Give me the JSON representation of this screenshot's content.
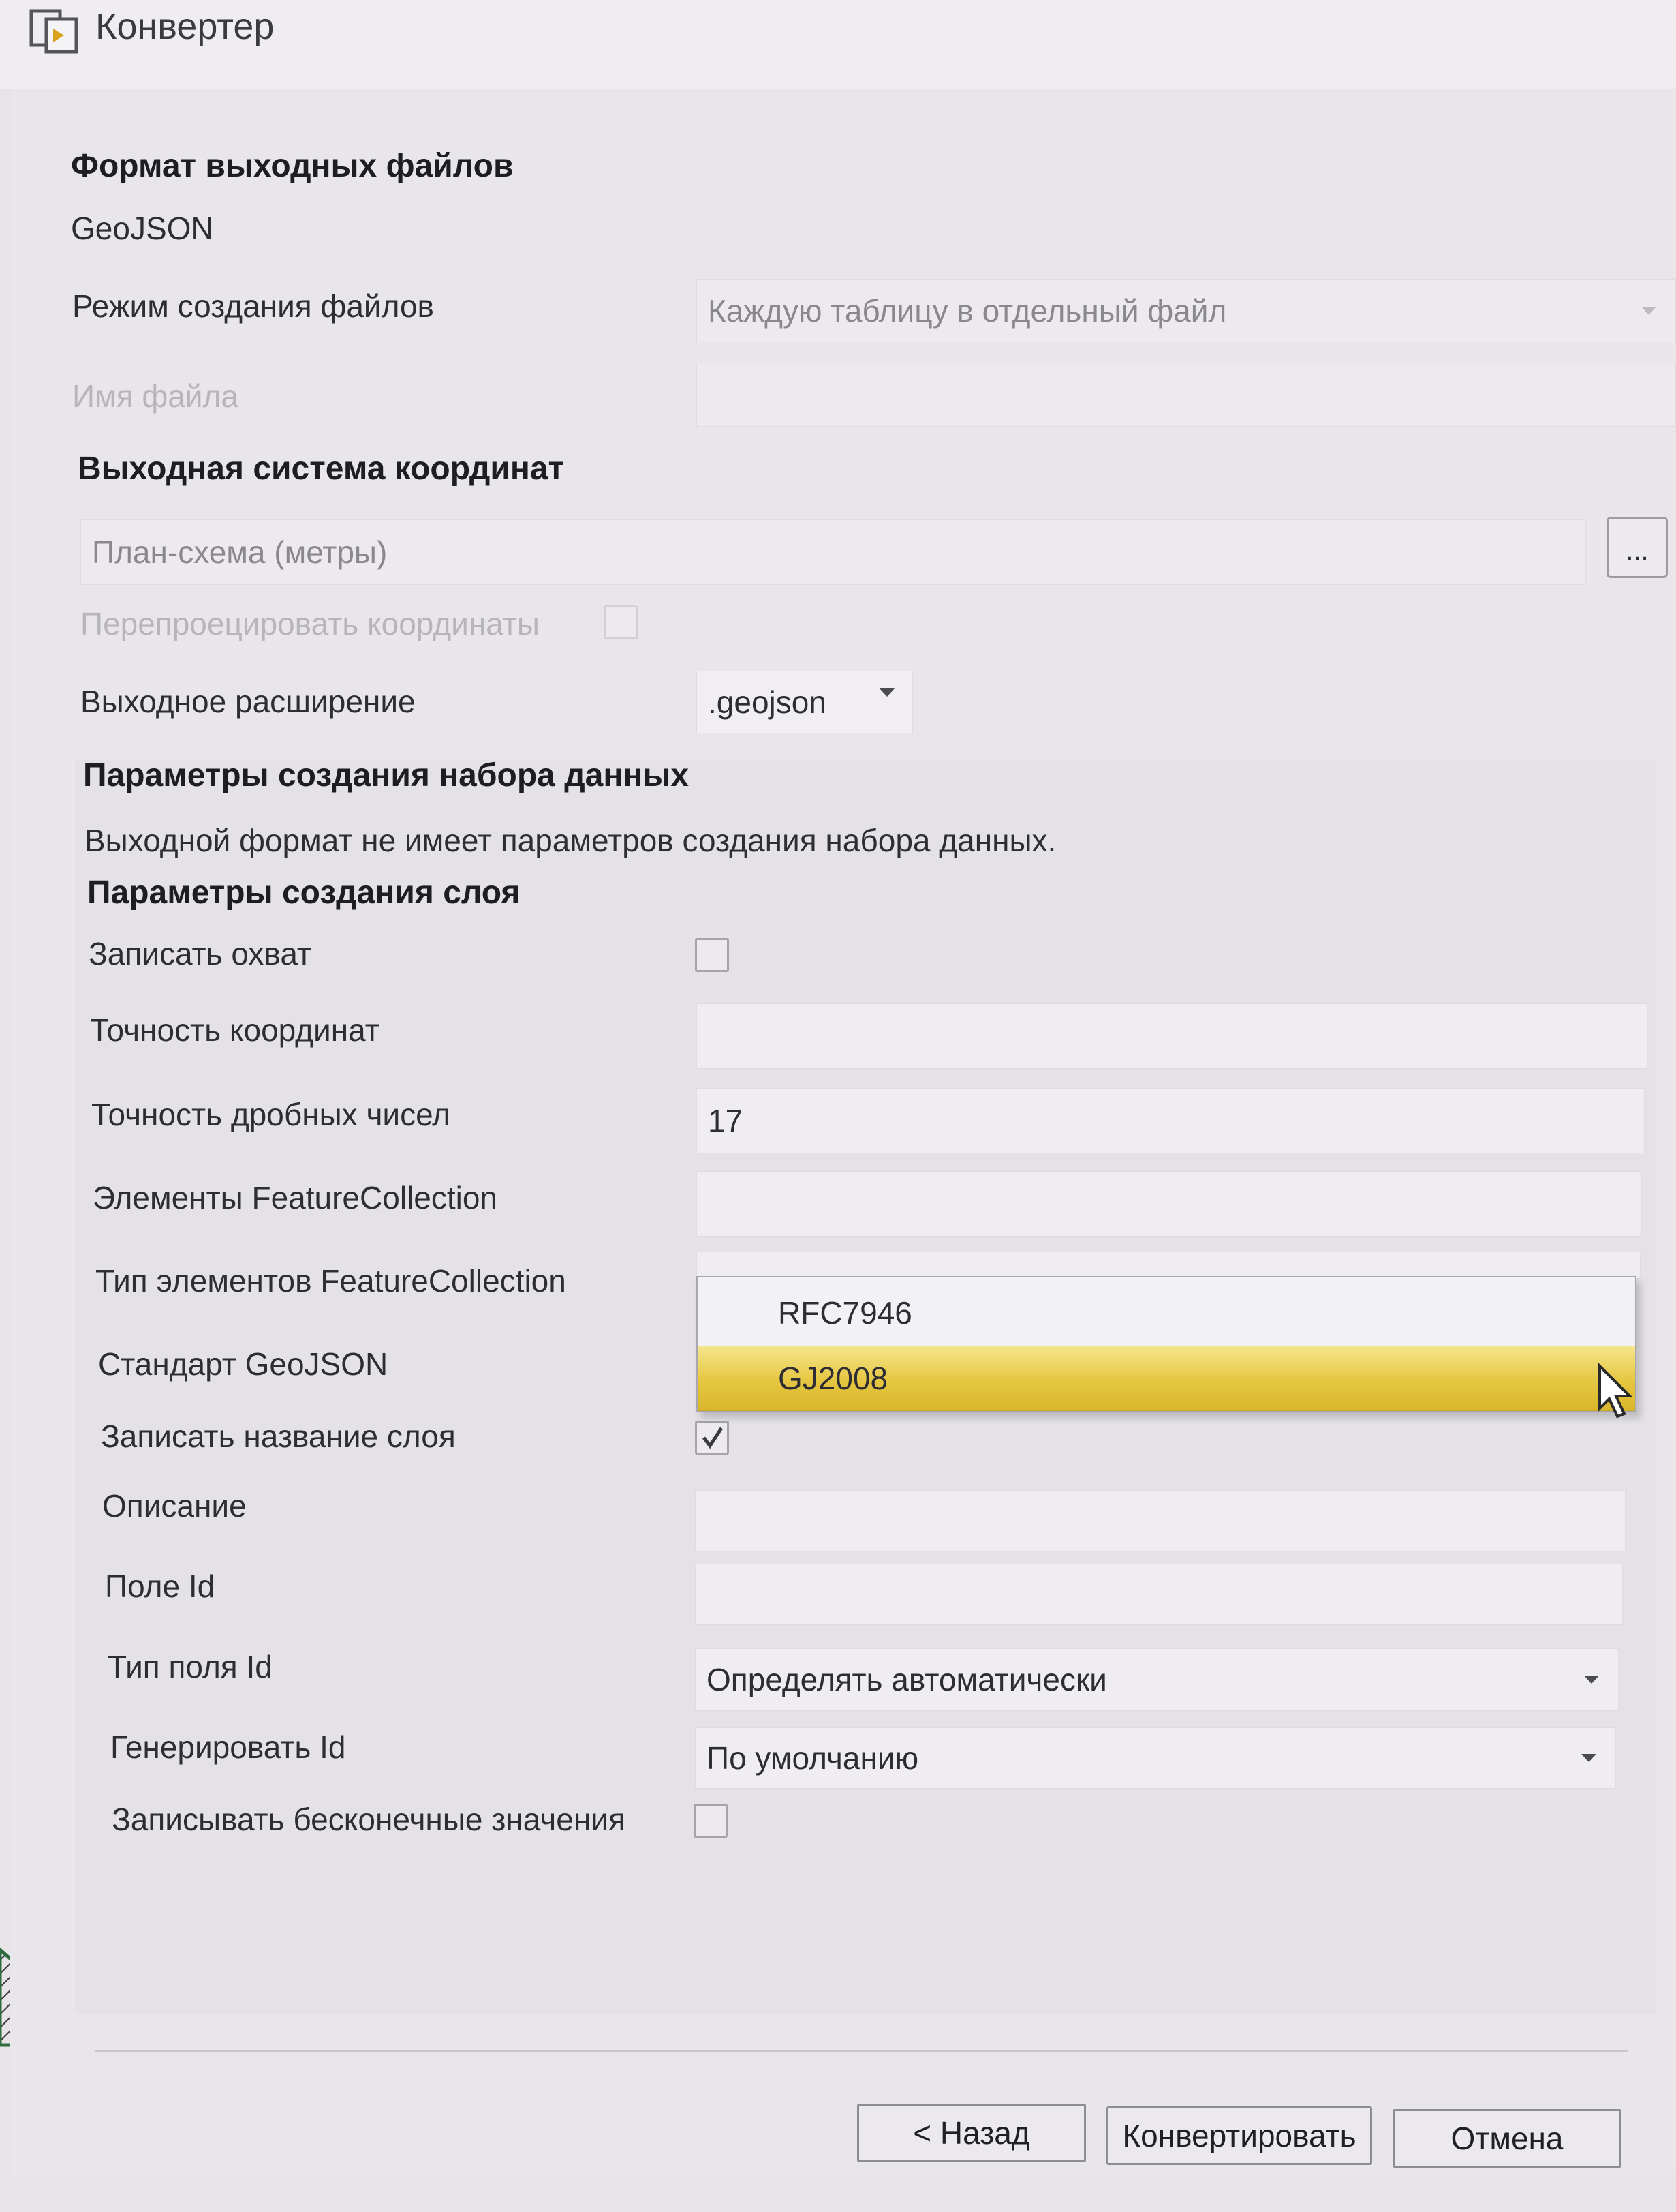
{
  "window": {
    "title": "Конвертер"
  },
  "output_format": {
    "heading": "Формат выходных файлов",
    "value": "GeoJSON",
    "mode_label": "Режим создания файлов",
    "mode_value": "Каждую таблицу в отдельный файл",
    "filename_label": "Имя файла",
    "filename_value": ""
  },
  "crs": {
    "heading": "Выходная система координат",
    "value": "План-схема (метры)",
    "browse_label": "...",
    "reproject_label": "Перепроецировать координаты",
    "reproject_checked": false,
    "extension_label": "Выходное расширение",
    "extension_value": ".geojson"
  },
  "dataset_params": {
    "heading": "Параметры создания набора данных",
    "note": "Выходной формат не имеет параметров создания набора данных."
  },
  "layer_params": {
    "heading": "Параметры создания слоя",
    "write_bbox_label": "Записать охват",
    "write_bbox_checked": false,
    "coord_precision_label": "Точность координат",
    "coord_precision_value": "",
    "significant_figures_label": "Точность дробных чисел",
    "significant_figures_value": "17",
    "fc_members_label": "Элементы FeatureCollection",
    "fc_members_value": "",
    "fc_type_label": "Тип элементов FeatureCollection",
    "standard_label": "Стандарт GeoJSON",
    "write_name_label": "Записать название слоя",
    "write_name_checked": true,
    "description_label": "Описание",
    "description_value": "",
    "id_field_label": "Поле Id",
    "id_field_value": "",
    "id_type_label": "Тип поля Id",
    "id_type_value": "Определять автоматически",
    "generate_id_label": "Генерировать Id",
    "generate_id_value": "По умолчанию",
    "write_nonfinite_label": "Записывать бесконечные значения",
    "write_nonfinite_checked": false
  },
  "dropdown": {
    "options": [
      "RFC7946",
      "GJ2008"
    ],
    "highlighted": "GJ2008"
  },
  "buttons": {
    "back": "< Назад",
    "convert": "Конвертировать",
    "cancel": "Отмена"
  },
  "colors": {
    "highlight": "#e6c640",
    "background": "#e8e6e9"
  }
}
